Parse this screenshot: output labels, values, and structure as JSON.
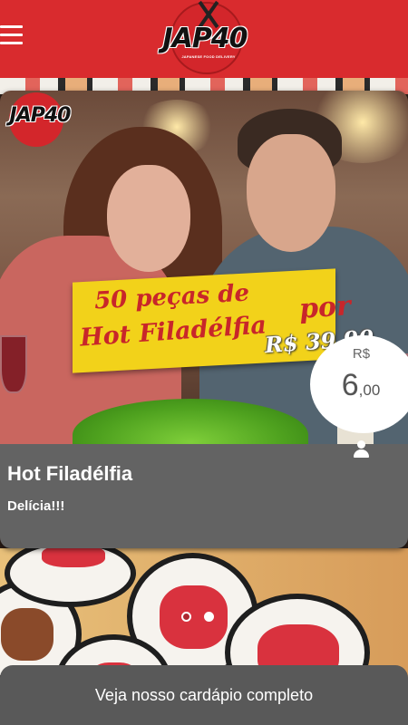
{
  "header": {
    "logo_text": "JAP40",
    "logo_tagline": "JAPANESE FOOD DELIVERY",
    "menu_icon": "hamburger-icon",
    "brand_color": "#d92b2e"
  },
  "promo_banner": {
    "logo_text": "JAP40",
    "line1": "50 peças de",
    "line2": "Hot Filadélfia",
    "por": "por",
    "price": "R$ 39,90"
  },
  "product": {
    "title": "Hot Filadélfia",
    "description": "Delícia!!!",
    "currency": "R$",
    "price_int": "6",
    "price_dec": ",00",
    "user_icon": "user-icon"
  },
  "carousel": {
    "total_slides": 2,
    "active_index": 0
  },
  "cta": {
    "label": "Veja nosso cardápio completo"
  }
}
